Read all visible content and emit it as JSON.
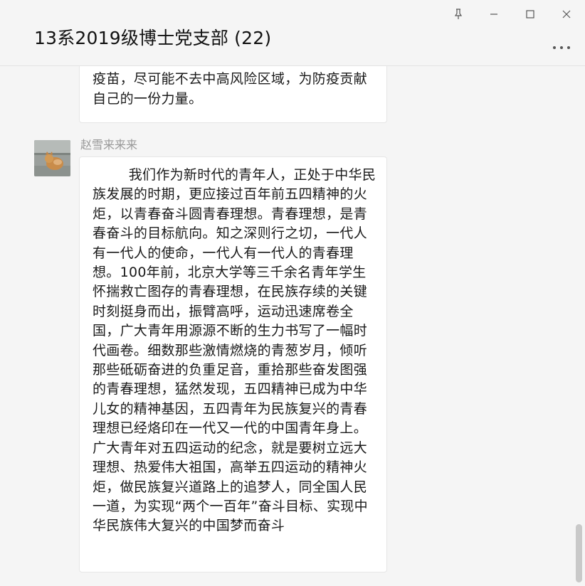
{
  "window": {
    "title": "13系2019级博士党支部 (22)",
    "pin_icon": "pin-icon",
    "minimize_icon": "minimize-icon",
    "maximize_icon": "maximize-icon",
    "close_icon": "close-icon",
    "more_icon": "more-options-icon",
    "minimize_glyph": "—",
    "maximize_glyph": "☐",
    "close_glyph": "✕",
    "more_glyph": "•••"
  },
  "messages": [
    {
      "text": "又遵守政府、学校的防疫规定，积极接种注射疫苗，尽可能不去中高风险区域，为防疫贡献自己的一份力量。"
    },
    {
      "sender": "赵雪来来来",
      "text": "        我们作为新时代的青年人，正处于中华民族发展的时期，更应接过百年前五四精神的火炬，以青春奋斗圆青春理想。青春理想，是青春奋斗的目标航向。知之深则行之切，一代人有一代人的使命，一代人有一代人的青春理想。100年前，北京大学等三千余名青年学生怀揣救亡图存的青春理想，在民族存续的关键时刻挺身而出，振臂高呼，运动迅速席卷全国，广大青年用源源不断的生力书写了一幅时代画卷。细数那些激情燃烧的青葱岁月，倾听那些砥砺奋进的负重足音，重拾那些奋发图强的青春理想，猛然发现，五四精神已成为中华儿女的精神基因，五四青年为民族复兴的青春理想已经烙印在一代又一代的中国青年身上。广大青年对五四运动的纪念，就是要树立远大理想、热爱伟大祖国，高举五四运动的精神火炬，做民族复兴道路上的追梦人，同全国人民一道，为实现“两个一百年”奋斗目标、实现中华民族伟大复兴的中国梦而奋斗"
    }
  ],
  "colors": {
    "background": "#f5f5f5",
    "bubble": "#ffffff",
    "sender_name": "#999999"
  }
}
